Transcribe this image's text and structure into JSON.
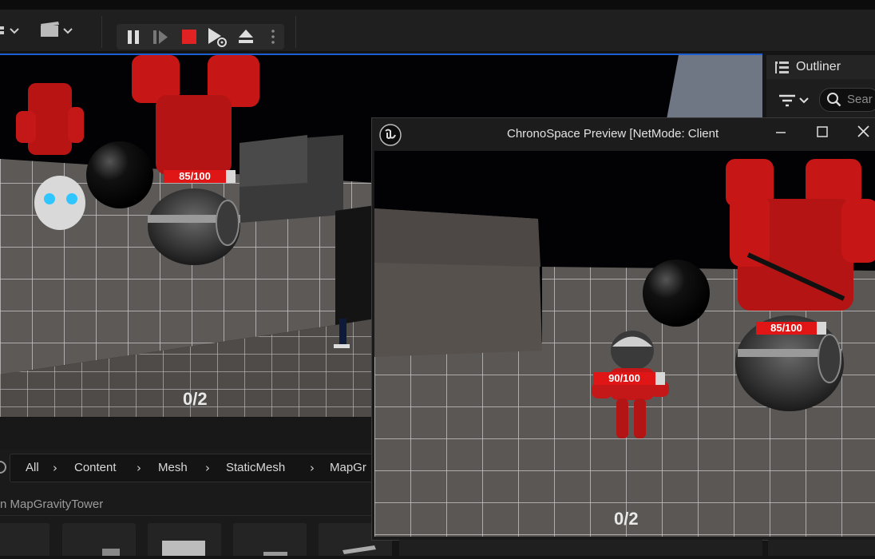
{
  "toolbar": {
    "pause_tooltip": "Pause",
    "icons": [
      "mode-menu-icon",
      "sequencer-icon",
      "pause-icon",
      "frame-skip-icon",
      "stop-icon",
      "play-options-icon",
      "eject-icon",
      "more-icon"
    ]
  },
  "viewport": {
    "health_left": "85/100",
    "counter": "0/2"
  },
  "outliner": {
    "title": "Outliner",
    "search_placeholder": "Sear"
  },
  "preview_window": {
    "title": "ChronoSpace Preview [NetMode: Client ",
    "health_a": "85/100",
    "health_b": "90/100",
    "counter": "0/2"
  },
  "content_browser": {
    "breadcrumbs": [
      "All",
      "Content",
      "Mesh",
      "StaticMesh",
      "MapGr"
    ],
    "folder_label": "n MapGravityTower"
  },
  "colors": {
    "accent_blue": "#1d5fd2",
    "stop_red": "#e02222",
    "health_red": "#e01515"
  }
}
